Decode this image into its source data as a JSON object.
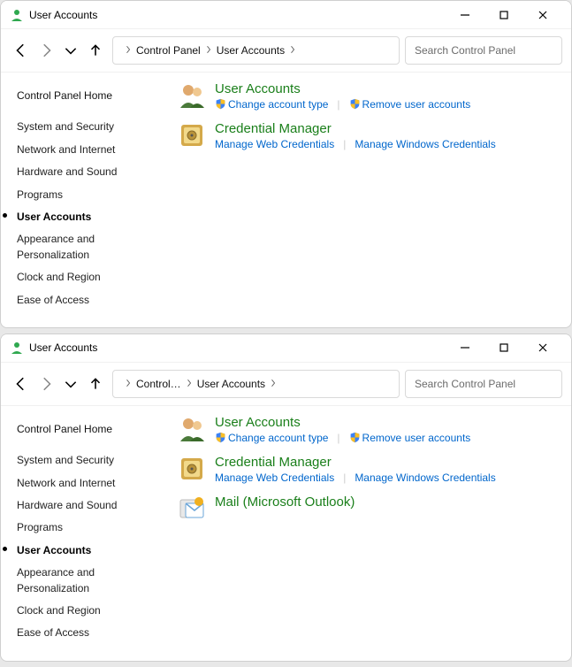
{
  "windows": [
    {
      "title": "User Accounts",
      "search_placeholder": "Search Control Panel",
      "breadcrumb": [
        "Control Panel",
        "User Accounts"
      ],
      "sidebar": {
        "home": "Control Panel Home",
        "items": [
          "System and Security",
          "Network and Internet",
          "Hardware and Sound",
          "Programs",
          "User Accounts",
          "Appearance and Personalization",
          "Clock and Region",
          "Ease of Access"
        ],
        "active_index": 4
      },
      "groups": [
        {
          "title": "User Accounts",
          "icon": "people",
          "links": [
            {
              "label": "Change account type",
              "shield": true
            },
            {
              "label": "Remove user accounts",
              "shield": true
            }
          ]
        },
        {
          "title": "Credential Manager",
          "icon": "safe",
          "links": [
            {
              "label": "Manage Web Credentials",
              "shield": false
            },
            {
              "label": "Manage Windows Credentials",
              "shield": false
            }
          ]
        }
      ]
    },
    {
      "title": "User Accounts",
      "search_placeholder": "Search Control Panel",
      "breadcrumb": [
        "Control…",
        "User Accounts"
      ],
      "sidebar": {
        "home": "Control Panel Home",
        "items": [
          "System and Security",
          "Network and Internet",
          "Hardware and Sound",
          "Programs",
          "User Accounts",
          "Appearance and Personalization",
          "Clock and Region",
          "Ease of Access"
        ],
        "active_index": 4
      },
      "groups": [
        {
          "title": "User Accounts",
          "icon": "people",
          "links": [
            {
              "label": "Change account type",
              "shield": true
            },
            {
              "label": "Remove user accounts",
              "shield": true
            }
          ]
        },
        {
          "title": "Credential Manager",
          "icon": "safe",
          "links": [
            {
              "label": "Manage Web Credentials",
              "shield": false
            },
            {
              "label": "Manage Windows Credentials",
              "shield": false
            }
          ]
        },
        {
          "title": "Mail (Microsoft Outlook)",
          "icon": "mail",
          "links": []
        }
      ]
    }
  ]
}
